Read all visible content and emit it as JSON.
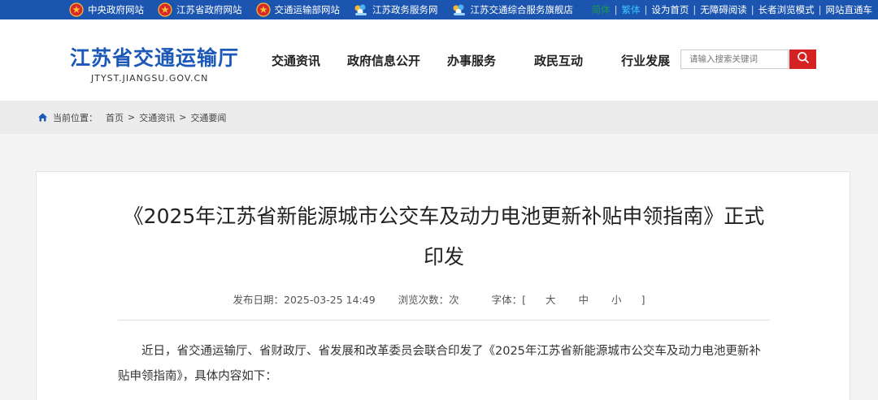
{
  "top_links": [
    {
      "label": "中央政府网站",
      "icon": "national-emblem-icon"
    },
    {
      "label": "江苏省政府网站",
      "icon": "national-emblem-icon"
    },
    {
      "label": "交通运输部网站",
      "icon": "national-emblem-icon"
    },
    {
      "label": "江苏政务服务网",
      "icon": "jiangsu-gov-service-icon"
    },
    {
      "label": "江苏交通综合服务旗舰店",
      "icon": "jiangsu-gov-service-icon"
    }
  ],
  "top_right": {
    "simplified": "简体",
    "traditional": "繁体",
    "set_home": "设为首页",
    "accessible": "无障碍阅读",
    "elder_mode": "长者浏览模式",
    "site_nav": "网站直通车"
  },
  "logo": {
    "cn": "江苏省交通运输厅",
    "en": "JTYST.JIANGSU.GOV.CN"
  },
  "nav": [
    "交通资讯",
    "政府信息公开",
    "办事服务",
    "政民互动",
    "行业发展"
  ],
  "search": {
    "placeholder": "请输入搜索关键词"
  },
  "breadcrumb": {
    "label": "当前位置：",
    "items": [
      "首页",
      "交通资讯",
      "交通要闻"
    ],
    "separator": ">"
  },
  "article": {
    "title_line1": "《2025年江苏省新能源城市公交车及动力电池更新补贴申领指南》正式",
    "title_line2": "印发",
    "date_label": "发布日期：2025-03-25 14:49",
    "views_label": "浏览次数：次",
    "font_label": "字体：[",
    "font_large": "大",
    "font_medium": "中",
    "font_small": "小",
    "font_end": "]",
    "paragraph": "近日，省交通运输厅、省财政厅、省发展和改革委员会联合印发了《2025年江苏省新能源城市公交车及动力电池更新补贴申领指南》，具体内容如下："
  },
  "colors": {
    "top_bar": "#1c55b0",
    "logo": "#1c58b8",
    "search_button": "#d42222"
  }
}
